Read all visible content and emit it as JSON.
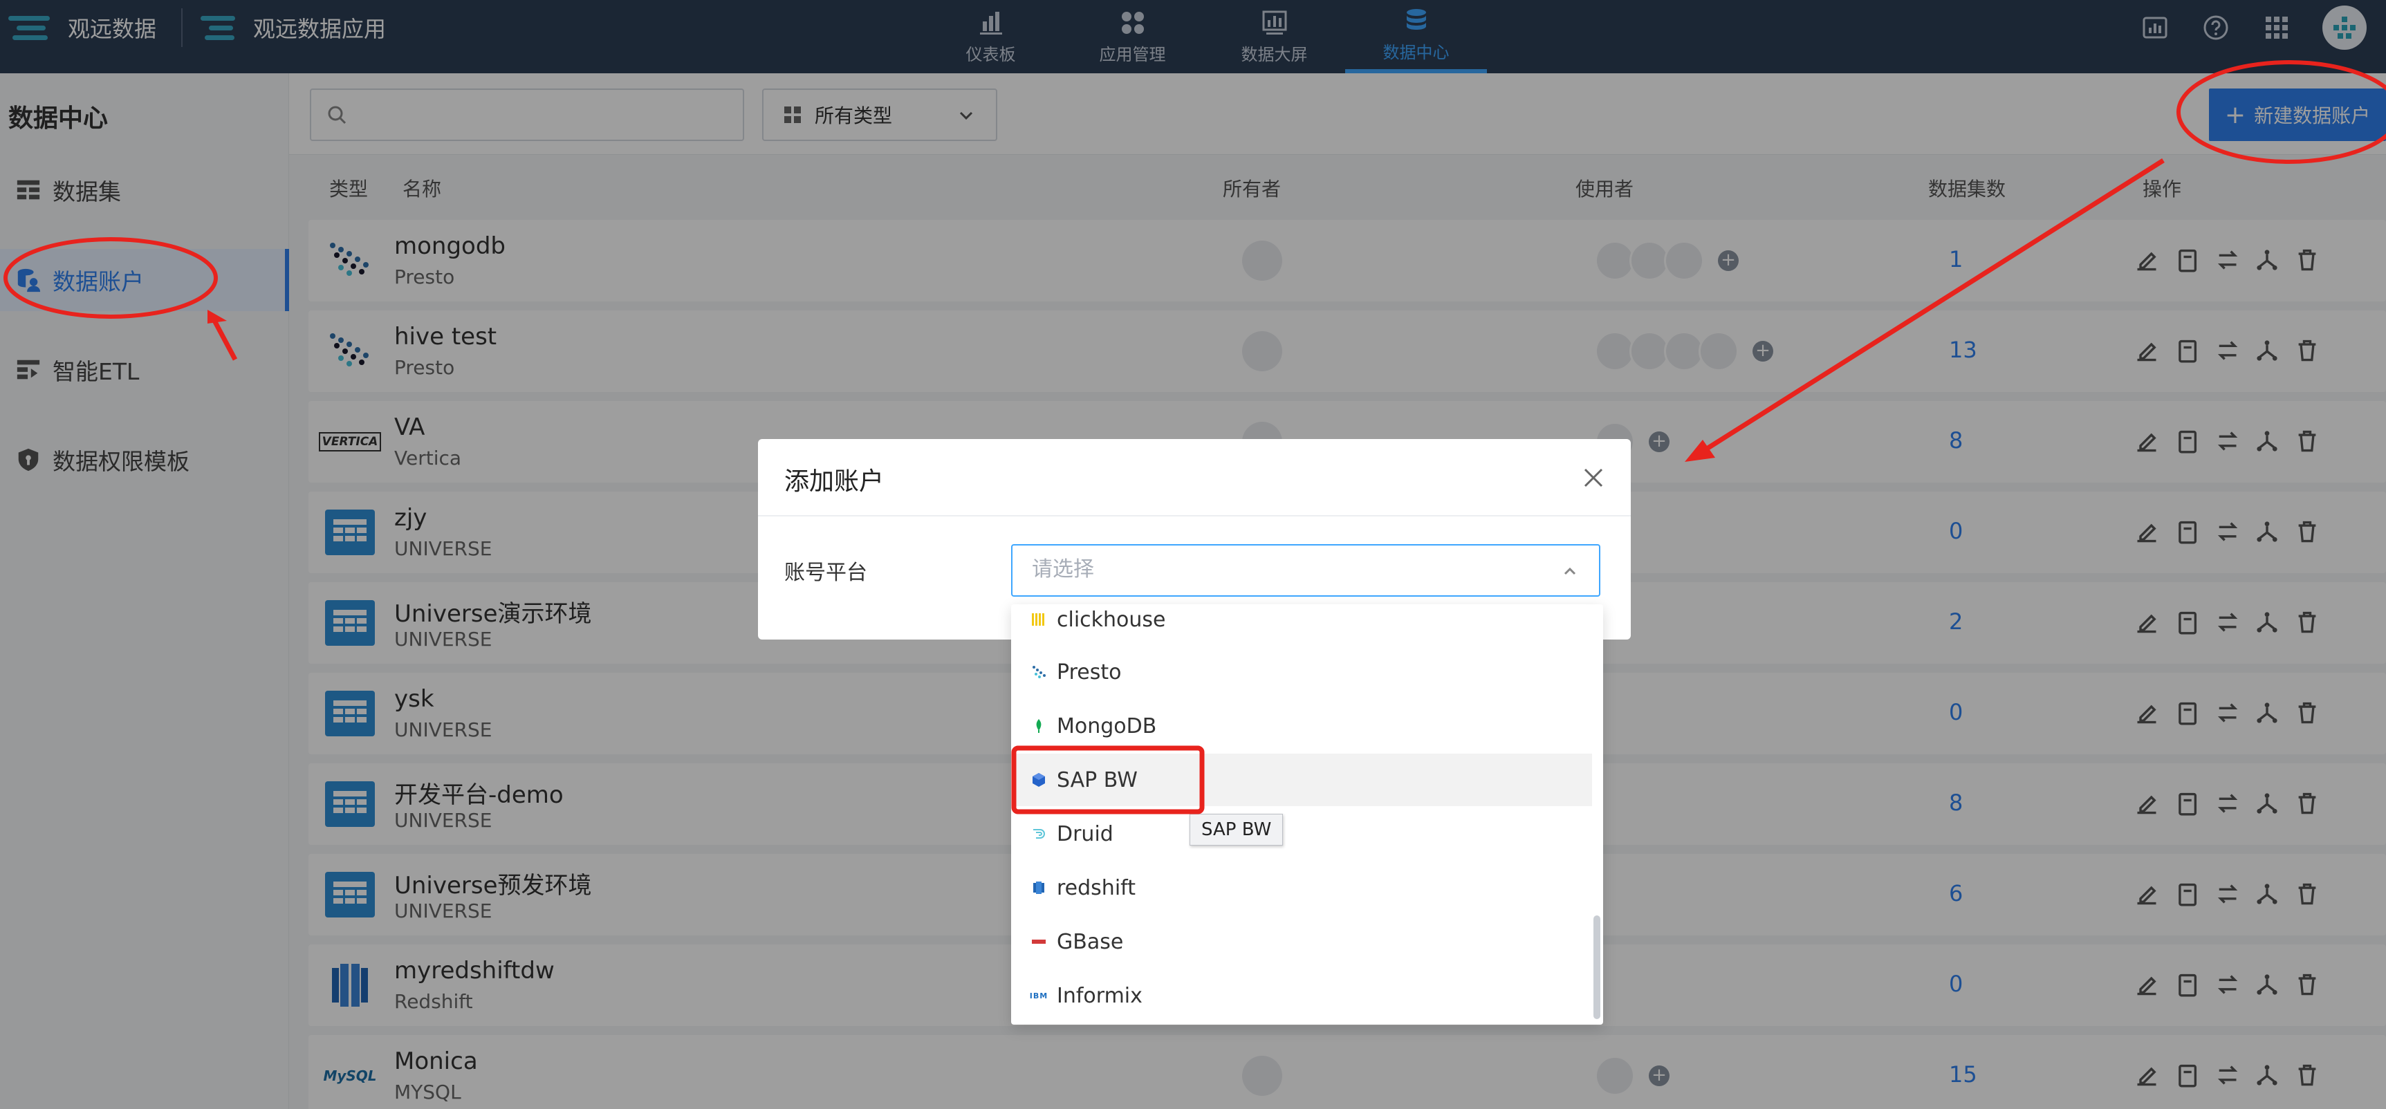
{
  "brand": {
    "primary": "观远数据",
    "secondary": "观远数据应用"
  },
  "nav": {
    "tabs": [
      {
        "label": "仪表板",
        "icon": "bar-chart-icon"
      },
      {
        "label": "应用管理",
        "icon": "apps-icon"
      },
      {
        "label": "数据大屏",
        "icon": "screen-icon"
      },
      {
        "label": "数据中心",
        "icon": "database-icon",
        "active": true
      }
    ]
  },
  "sidebar": {
    "title": "数据中心",
    "items": [
      {
        "label": "数据集",
        "icon": "dataset-icon"
      },
      {
        "label": "数据账户",
        "icon": "account-icon",
        "active": true
      },
      {
        "label": "智能ETL",
        "icon": "etl-icon"
      },
      {
        "label": "数据权限模板",
        "icon": "shield-icon"
      }
    ]
  },
  "toolbar": {
    "search_placeholder": "",
    "type_select": "所有类型",
    "new_button": "新建数据账户"
  },
  "table": {
    "headers": {
      "type": "类型",
      "name": "名称",
      "owner": "所有者",
      "users": "使用者",
      "count": "数据集数",
      "ops": "操作"
    },
    "rows": [
      {
        "name": "mongodb",
        "type": "Presto",
        "count": "1"
      },
      {
        "name": "hive test",
        "type": "Presto",
        "count": "13"
      },
      {
        "name": "VA",
        "type": "Vertica",
        "count": "8",
        "logo": "VERTICA"
      },
      {
        "name": "zjy",
        "type": "UNIVERSE",
        "count": "0"
      },
      {
        "name": "Universe演示环境",
        "type": "UNIVERSE",
        "count": "2"
      },
      {
        "name": "ysk",
        "type": "UNIVERSE",
        "count": "0"
      },
      {
        "name": "开发平台-demo",
        "type": "UNIVERSE",
        "count": "8"
      },
      {
        "name": "Universe预发环境",
        "type": "UNIVERSE",
        "count": "6"
      },
      {
        "name": "myredshiftdw",
        "type": "Redshift",
        "count": "0"
      },
      {
        "name": "Monica",
        "type": "MYSQL",
        "count": "15",
        "logo": "MySQL"
      }
    ]
  },
  "dialog": {
    "title": "添加账户",
    "field_label": "账号平台",
    "placeholder": "请选择"
  },
  "dropdown": {
    "options": [
      "clickhouse",
      "Presto",
      "MongoDB",
      "SAP BW",
      "Druid",
      "redshift",
      "GBase",
      "Informix"
    ],
    "option_logos": [
      "",
      "",
      "",
      "",
      "",
      "",
      "",
      "IBM"
    ],
    "hovered": "SAP BW",
    "tooltip": "SAP BW"
  },
  "colors": {
    "accent": "#2f80ed",
    "topbar": "#2d3e55",
    "annotation": "#e8231d"
  }
}
